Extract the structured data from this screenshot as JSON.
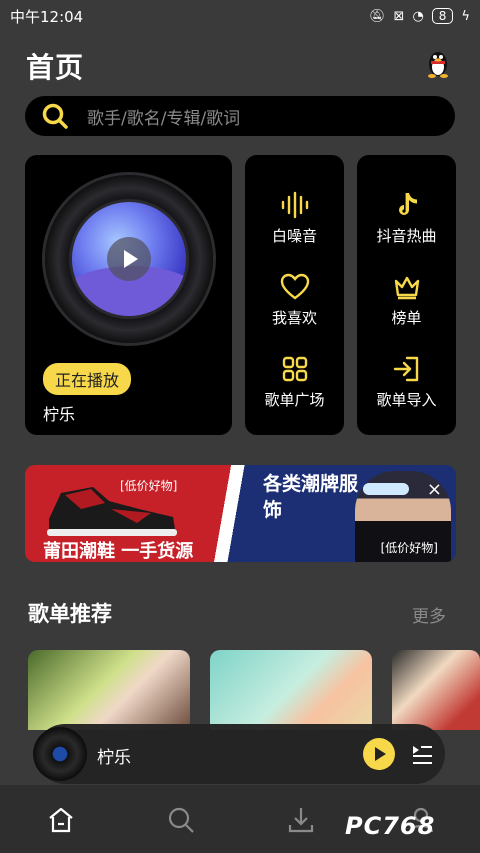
{
  "status_bar": {
    "time": "中午12:04",
    "battery": "8"
  },
  "header": {
    "title": "首页"
  },
  "search": {
    "placeholder": "歌手/歌名/专辑/歌词"
  },
  "now_playing_card": {
    "button": "正在播放",
    "song": "柠乐"
  },
  "quick_grid": [
    {
      "label": "白噪音",
      "icon": "waveform-icon"
    },
    {
      "label": "抖音热曲",
      "icon": "tiktok-note-icon"
    },
    {
      "label": "我喜欢",
      "icon": "heart-icon"
    },
    {
      "label": "榜单",
      "icon": "crown-icon"
    },
    {
      "label": "歌单广场",
      "icon": "grid-icon"
    },
    {
      "label": "歌单导入",
      "icon": "import-icon"
    }
  ],
  "banner": {
    "tag_left": "[低价好物]",
    "headline_left": "莆田潮鞋  一手货源",
    "headline_right": "各类潮牌服饰",
    "tag_right": "[低价好物]",
    "close": "×"
  },
  "section": {
    "title": "歌单推荐",
    "more": "更多"
  },
  "mini_player": {
    "song": "柠乐"
  },
  "watermark": "PC768",
  "colors": {
    "accent": "#f7d84a",
    "background": "#3a3a3a",
    "card": "#000000"
  }
}
